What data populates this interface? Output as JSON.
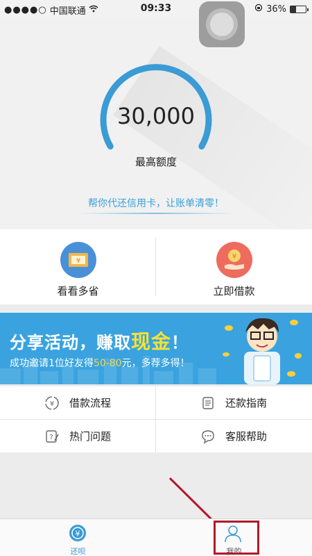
{
  "status_bar": {
    "carrier": "中国联通",
    "time": "09:33",
    "battery": "36%",
    "battery_level": 0.36
  },
  "hero": {
    "limit_value": "30,000",
    "limit_label": "最高额度",
    "slogan": "帮你代还信用卡，让账单清零！",
    "accent_color": "#3a9bd5"
  },
  "actions": [
    {
      "label": "看看多省",
      "icon": "ticket-coupon-icon",
      "color": "#f2b64a"
    },
    {
      "label": "立即借款",
      "icon": "coin-hand-icon",
      "color": "#ee6b5e"
    }
  ],
  "banner": {
    "title_main": "分享活动，赚取",
    "title_highlight": "现金",
    "title_end": "！",
    "subtitle_start": "成功邀请1位好友得",
    "subtitle_amount": "50-80",
    "subtitle_end": "元，多荐多得！"
  },
  "menu": [
    {
      "label": "借款流程",
      "icon": "yen-cycle-icon"
    },
    {
      "label": "还款指南",
      "icon": "scroll-icon"
    },
    {
      "label": "热门问题",
      "icon": "edit-question-icon"
    },
    {
      "label": "客服帮助",
      "icon": "chat-bubble-icon"
    }
  ],
  "tabbar": {
    "tabs": [
      {
        "label": "还呗",
        "icon": "yen-cycle-icon",
        "active": true,
        "color": "#3a9bd5"
      },
      {
        "label": "我的",
        "icon": "person-icon",
        "active": false,
        "color": "#555555"
      }
    ]
  },
  "annotation": {
    "color": "#b1182b"
  }
}
